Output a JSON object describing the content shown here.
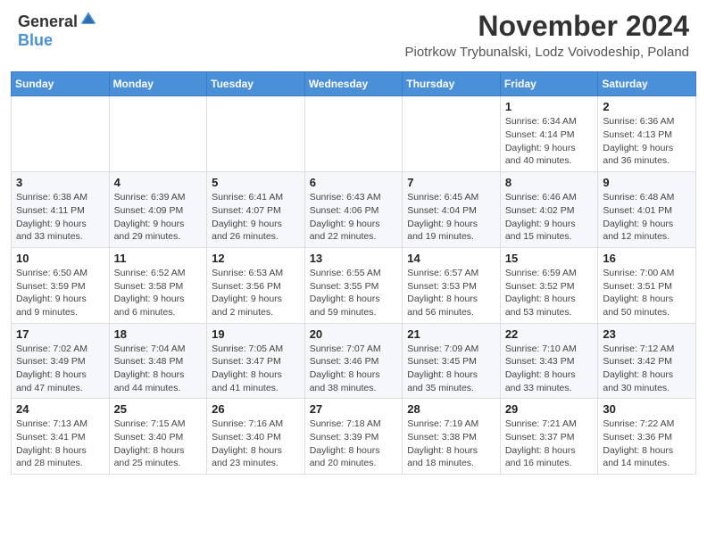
{
  "header": {
    "logo_general": "General",
    "logo_blue": "Blue",
    "title": "November 2024",
    "subtitle": "Piotrkow Trybunalski, Lodz Voivodeship, Poland"
  },
  "calendar": {
    "headers": [
      "Sunday",
      "Monday",
      "Tuesday",
      "Wednesday",
      "Thursday",
      "Friday",
      "Saturday"
    ],
    "weeks": [
      [
        {
          "num": "",
          "info": ""
        },
        {
          "num": "",
          "info": ""
        },
        {
          "num": "",
          "info": ""
        },
        {
          "num": "",
          "info": ""
        },
        {
          "num": "",
          "info": ""
        },
        {
          "num": "1",
          "info": "Sunrise: 6:34 AM\nSunset: 4:14 PM\nDaylight: 9 hours\nand 40 minutes."
        },
        {
          "num": "2",
          "info": "Sunrise: 6:36 AM\nSunset: 4:13 PM\nDaylight: 9 hours\nand 36 minutes."
        }
      ],
      [
        {
          "num": "3",
          "info": "Sunrise: 6:38 AM\nSunset: 4:11 PM\nDaylight: 9 hours\nand 33 minutes."
        },
        {
          "num": "4",
          "info": "Sunrise: 6:39 AM\nSunset: 4:09 PM\nDaylight: 9 hours\nand 29 minutes."
        },
        {
          "num": "5",
          "info": "Sunrise: 6:41 AM\nSunset: 4:07 PM\nDaylight: 9 hours\nand 26 minutes."
        },
        {
          "num": "6",
          "info": "Sunrise: 6:43 AM\nSunset: 4:06 PM\nDaylight: 9 hours\nand 22 minutes."
        },
        {
          "num": "7",
          "info": "Sunrise: 6:45 AM\nSunset: 4:04 PM\nDaylight: 9 hours\nand 19 minutes."
        },
        {
          "num": "8",
          "info": "Sunrise: 6:46 AM\nSunset: 4:02 PM\nDaylight: 9 hours\nand 15 minutes."
        },
        {
          "num": "9",
          "info": "Sunrise: 6:48 AM\nSunset: 4:01 PM\nDaylight: 9 hours\nand 12 minutes."
        }
      ],
      [
        {
          "num": "10",
          "info": "Sunrise: 6:50 AM\nSunset: 3:59 PM\nDaylight: 9 hours\nand 9 minutes."
        },
        {
          "num": "11",
          "info": "Sunrise: 6:52 AM\nSunset: 3:58 PM\nDaylight: 9 hours\nand 6 minutes."
        },
        {
          "num": "12",
          "info": "Sunrise: 6:53 AM\nSunset: 3:56 PM\nDaylight: 9 hours\nand 2 minutes."
        },
        {
          "num": "13",
          "info": "Sunrise: 6:55 AM\nSunset: 3:55 PM\nDaylight: 8 hours\nand 59 minutes."
        },
        {
          "num": "14",
          "info": "Sunrise: 6:57 AM\nSunset: 3:53 PM\nDaylight: 8 hours\nand 56 minutes."
        },
        {
          "num": "15",
          "info": "Sunrise: 6:59 AM\nSunset: 3:52 PM\nDaylight: 8 hours\nand 53 minutes."
        },
        {
          "num": "16",
          "info": "Sunrise: 7:00 AM\nSunset: 3:51 PM\nDaylight: 8 hours\nand 50 minutes."
        }
      ],
      [
        {
          "num": "17",
          "info": "Sunrise: 7:02 AM\nSunset: 3:49 PM\nDaylight: 8 hours\nand 47 minutes."
        },
        {
          "num": "18",
          "info": "Sunrise: 7:04 AM\nSunset: 3:48 PM\nDaylight: 8 hours\nand 44 minutes."
        },
        {
          "num": "19",
          "info": "Sunrise: 7:05 AM\nSunset: 3:47 PM\nDaylight: 8 hours\nand 41 minutes."
        },
        {
          "num": "20",
          "info": "Sunrise: 7:07 AM\nSunset: 3:46 PM\nDaylight: 8 hours\nand 38 minutes."
        },
        {
          "num": "21",
          "info": "Sunrise: 7:09 AM\nSunset: 3:45 PM\nDaylight: 8 hours\nand 35 minutes."
        },
        {
          "num": "22",
          "info": "Sunrise: 7:10 AM\nSunset: 3:43 PM\nDaylight: 8 hours\nand 33 minutes."
        },
        {
          "num": "23",
          "info": "Sunrise: 7:12 AM\nSunset: 3:42 PM\nDaylight: 8 hours\nand 30 minutes."
        }
      ],
      [
        {
          "num": "24",
          "info": "Sunrise: 7:13 AM\nSunset: 3:41 PM\nDaylight: 8 hours\nand 28 minutes."
        },
        {
          "num": "25",
          "info": "Sunrise: 7:15 AM\nSunset: 3:40 PM\nDaylight: 8 hours\nand 25 minutes."
        },
        {
          "num": "26",
          "info": "Sunrise: 7:16 AM\nSunset: 3:40 PM\nDaylight: 8 hours\nand 23 minutes."
        },
        {
          "num": "27",
          "info": "Sunrise: 7:18 AM\nSunset: 3:39 PM\nDaylight: 8 hours\nand 20 minutes."
        },
        {
          "num": "28",
          "info": "Sunrise: 7:19 AM\nSunset: 3:38 PM\nDaylight: 8 hours\nand 18 minutes."
        },
        {
          "num": "29",
          "info": "Sunrise: 7:21 AM\nSunset: 3:37 PM\nDaylight: 8 hours\nand 16 minutes."
        },
        {
          "num": "30",
          "info": "Sunrise: 7:22 AM\nSunset: 3:36 PM\nDaylight: 8 hours\nand 14 minutes."
        }
      ]
    ]
  }
}
